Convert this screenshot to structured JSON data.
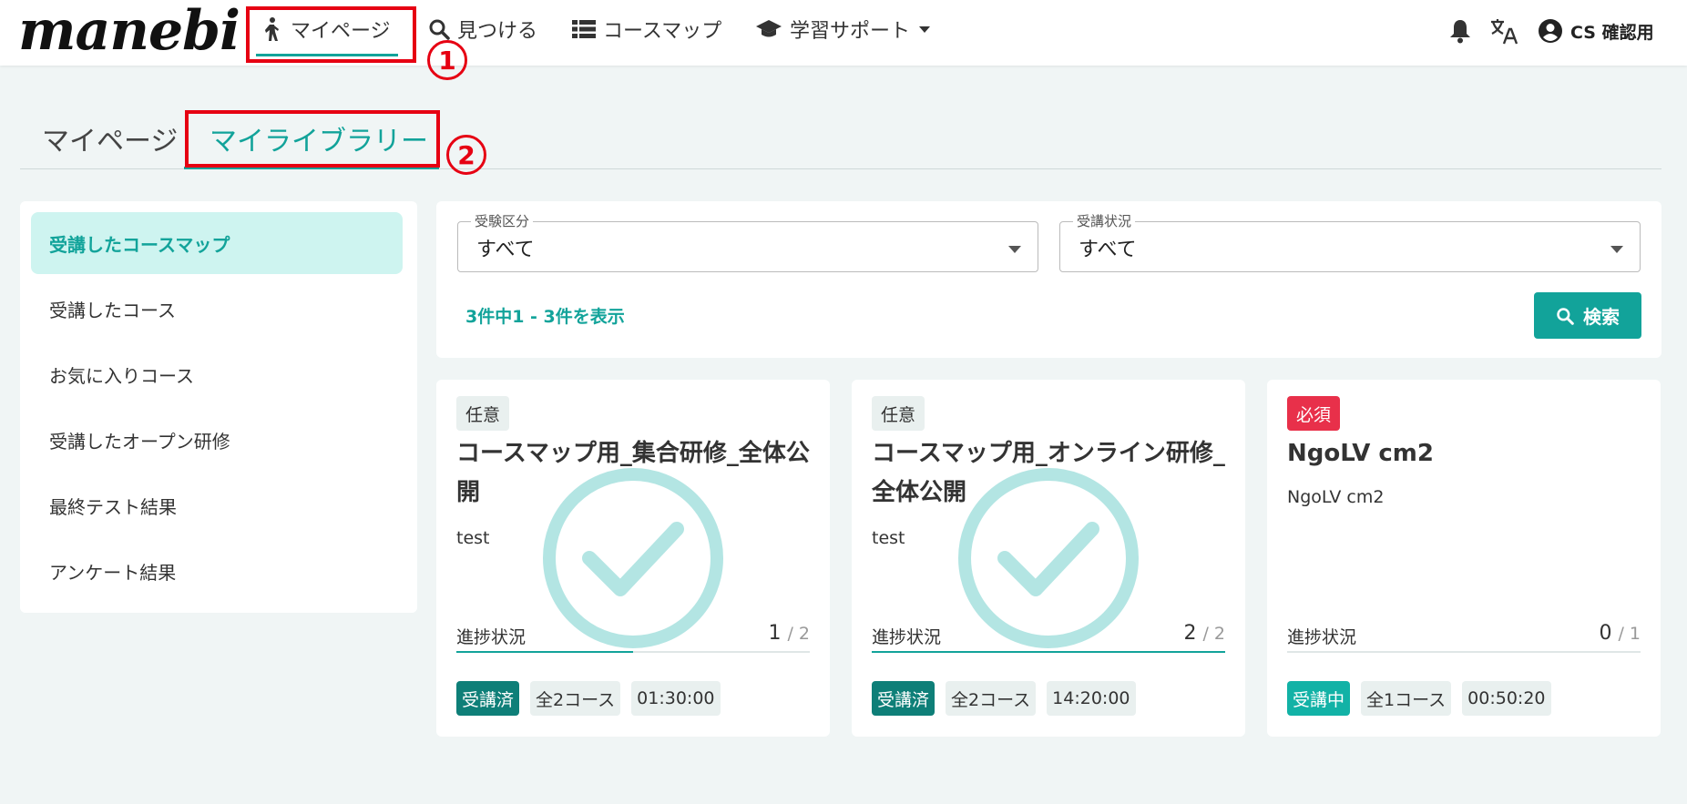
{
  "header": {
    "logo": "manebi",
    "nav": [
      {
        "label": "マイページ",
        "icon": "person-walking-icon"
      },
      {
        "label": "見つける",
        "icon": "search-icon"
      },
      {
        "label": "コースマップ",
        "icon": "list-icon"
      },
      {
        "label": "学習サポート",
        "icon": "graduation-cap-icon"
      }
    ],
    "user": "CS 確認用",
    "annotation_1": "1",
    "annotation_2": "2"
  },
  "tabs": [
    "マイページ",
    "マイライブラリー"
  ],
  "sidebar": {
    "items": [
      "受講したコースマップ",
      "受講したコース",
      "お気に入りコース",
      "受講したオープン研修",
      "最終テスト結果",
      "アンケート結果"
    ]
  },
  "filters": {
    "exam_type": {
      "label": "受験区分",
      "value": "すべて"
    },
    "status": {
      "label": "受講状況",
      "value": "すべて"
    },
    "count_text": "3件中1 - 3件を表示",
    "search_label": "検索"
  },
  "cards": [
    {
      "badge": "任意",
      "title": "コースマップ用_集合研修_全体公開",
      "desc": "test",
      "progress_label": "進捗状況",
      "done": "1",
      "total": "/ 2",
      "progress": 0.5,
      "status": "受講済",
      "courses": "全2コース",
      "time": "01:30:00",
      "completed": true
    },
    {
      "badge": "任意",
      "title": "コースマップ用_オンライン研修_全体公開",
      "desc": "test",
      "progress_label": "進捗状況",
      "done": "2",
      "total": "/ 2",
      "progress": 1.0,
      "status": "受講済",
      "courses": "全2コース",
      "time": "14:20:00",
      "completed": true
    },
    {
      "badge": "必須",
      "title": "NgoLV cm2",
      "desc": "NgoLV cm2",
      "progress_label": "進捗状況",
      "done": "0",
      "total": "/ 1",
      "progress": 0,
      "status": "受講中",
      "courses": "全1コース",
      "time": "00:50:20",
      "completed": false
    }
  ],
  "colors": {
    "accent": "#12a39a",
    "required": "#e8304a",
    "highlight": "#e60012"
  }
}
